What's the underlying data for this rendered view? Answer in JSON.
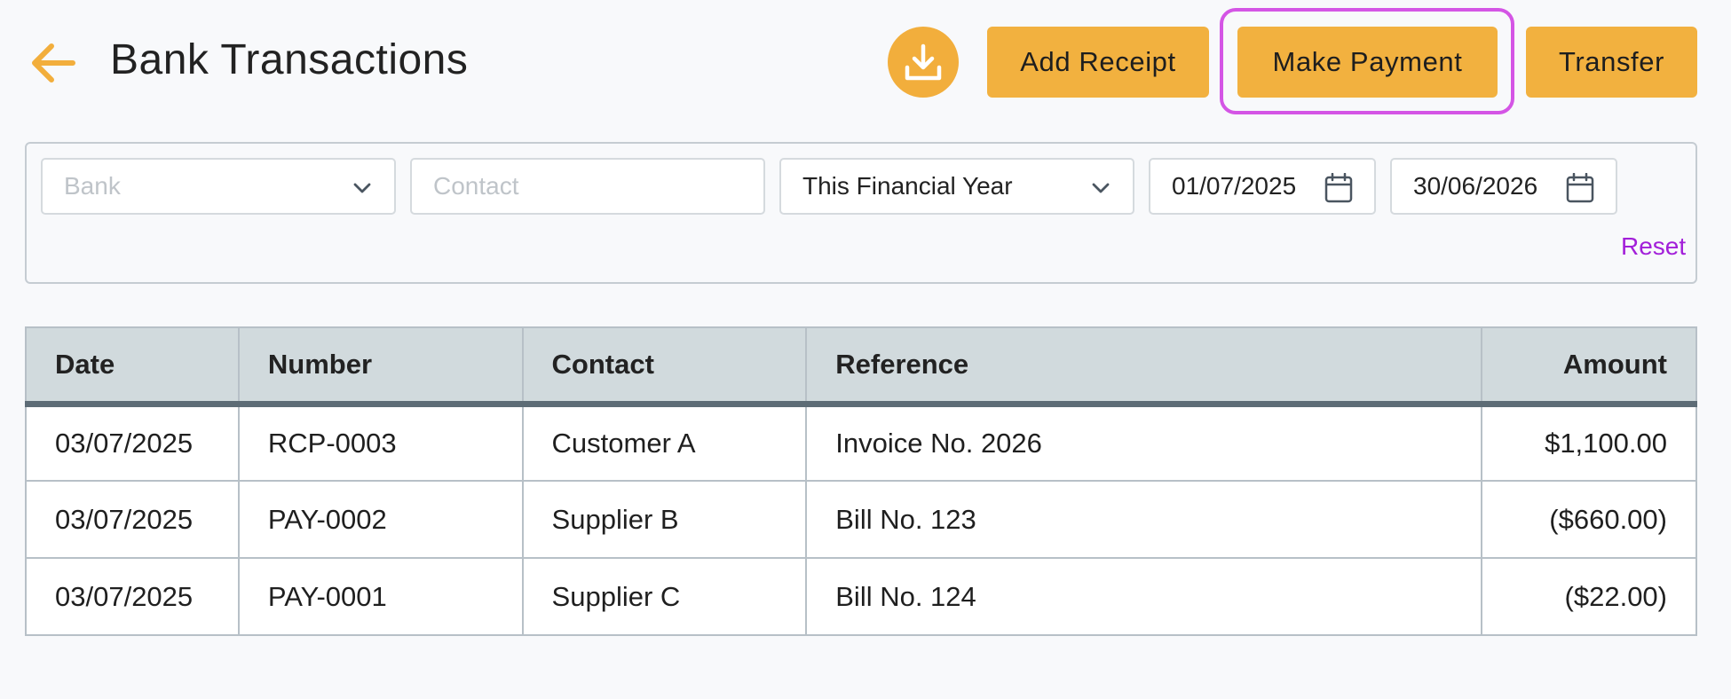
{
  "header": {
    "title": "Bank Transactions",
    "back_icon": "arrow-left-icon",
    "download_icon": "download-icon",
    "buttons": {
      "add_receipt": "Add Receipt",
      "make_payment": "Make Payment",
      "transfer": "Transfer"
    }
  },
  "filters": {
    "bank": {
      "placeholder": "Bank"
    },
    "contact": {
      "placeholder": "Contact"
    },
    "period": {
      "value": "This Financial Year"
    },
    "date_from": "01/07/2025",
    "date_to": "30/06/2026",
    "reset": "Reset"
  },
  "table": {
    "columns": [
      "Date",
      "Number",
      "Contact",
      "Reference",
      "Amount"
    ],
    "rows": [
      {
        "date": "03/07/2025",
        "number": "RCP-0003",
        "contact": "Customer A",
        "reference": "Invoice No. 2026",
        "amount": "$1,100.00"
      },
      {
        "date": "03/07/2025",
        "number": "PAY-0002",
        "contact": "Supplier B",
        "reference": "Bill No. 123",
        "amount": "($660.00)"
      },
      {
        "date": "03/07/2025",
        "number": "PAY-0001",
        "contact": "Supplier C",
        "reference": "Bill No. 124",
        "amount": "($22.00)"
      }
    ]
  },
  "colors": {
    "accent": "#f2b13f",
    "focus_ring": "#d455e5",
    "reset_link": "#a21fd9",
    "table_header": "#d1dadd"
  }
}
